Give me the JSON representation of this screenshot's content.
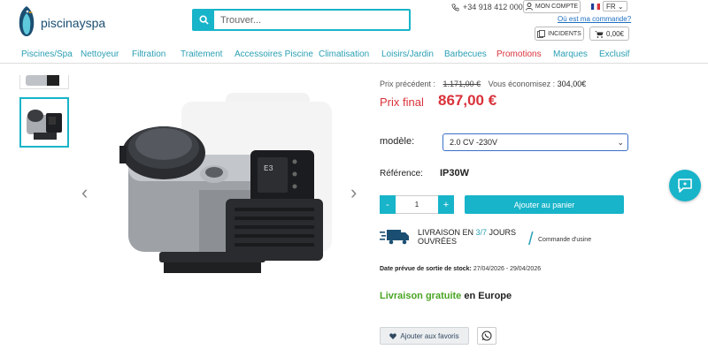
{
  "header": {
    "logo_text": "piscinayspa",
    "search_placeholder": "Trouver...",
    "phone": "+34 918 412 000",
    "account_label": "MON COMPTE",
    "lang": "FR",
    "order_link": "Où est ma commande?",
    "incidents_label": "INCIDENTS",
    "cart_amount": "0,00€"
  },
  "nav": {
    "items": [
      "Piscines/Spa",
      "Nettoyeur",
      "Filtration",
      "Traitement",
      "Accessoires Piscine",
      "Climatisation",
      "Loisirs/Jardin",
      "Barbecues",
      "Promotions",
      "Marques",
      "Exclusif"
    ]
  },
  "product": {
    "prev_label": "Prix précédent :",
    "prev_price": "1.171,00 €",
    "save_label": "Vous économisez :",
    "save_value": "304,00€",
    "final_label": "Prix final",
    "final_price": "867,00 €",
    "model_label": "modèle:",
    "model_value": "2.0 CV -230V",
    "ref_label": "Référence:",
    "ref_value": "IP30W",
    "qty": "1",
    "qty_minus": "-",
    "qty_plus": "+",
    "add_to_cart": "Ajouter au panier",
    "delivery_prefix": "LIVRAISON EN ",
    "delivery_days": "3/7",
    "delivery_suffix": " JOURS OUVRÉES",
    "order_factory": "Commande d'usine",
    "stock_label": "Date prévue de sortie de stock:",
    "stock_dates": " 27/04/2026 - 29/04/2026",
    "free_delivery_green": "Livraison gratuite",
    "free_delivery_rest": " en Europe",
    "favorites": "Ajouter aux favoris"
  },
  "colors": {
    "accent": "#18b4c9",
    "price_red": "#d9323a",
    "free_green": "#4aa524"
  },
  "icons": [
    "search-icon",
    "phone-icon",
    "user-icon",
    "flag-icon",
    "incidents-icon",
    "cart-icon",
    "chevron-left-icon",
    "chevron-right-icon",
    "truck-icon",
    "heart-icon",
    "whatsapp-icon",
    "chat-icon"
  ]
}
